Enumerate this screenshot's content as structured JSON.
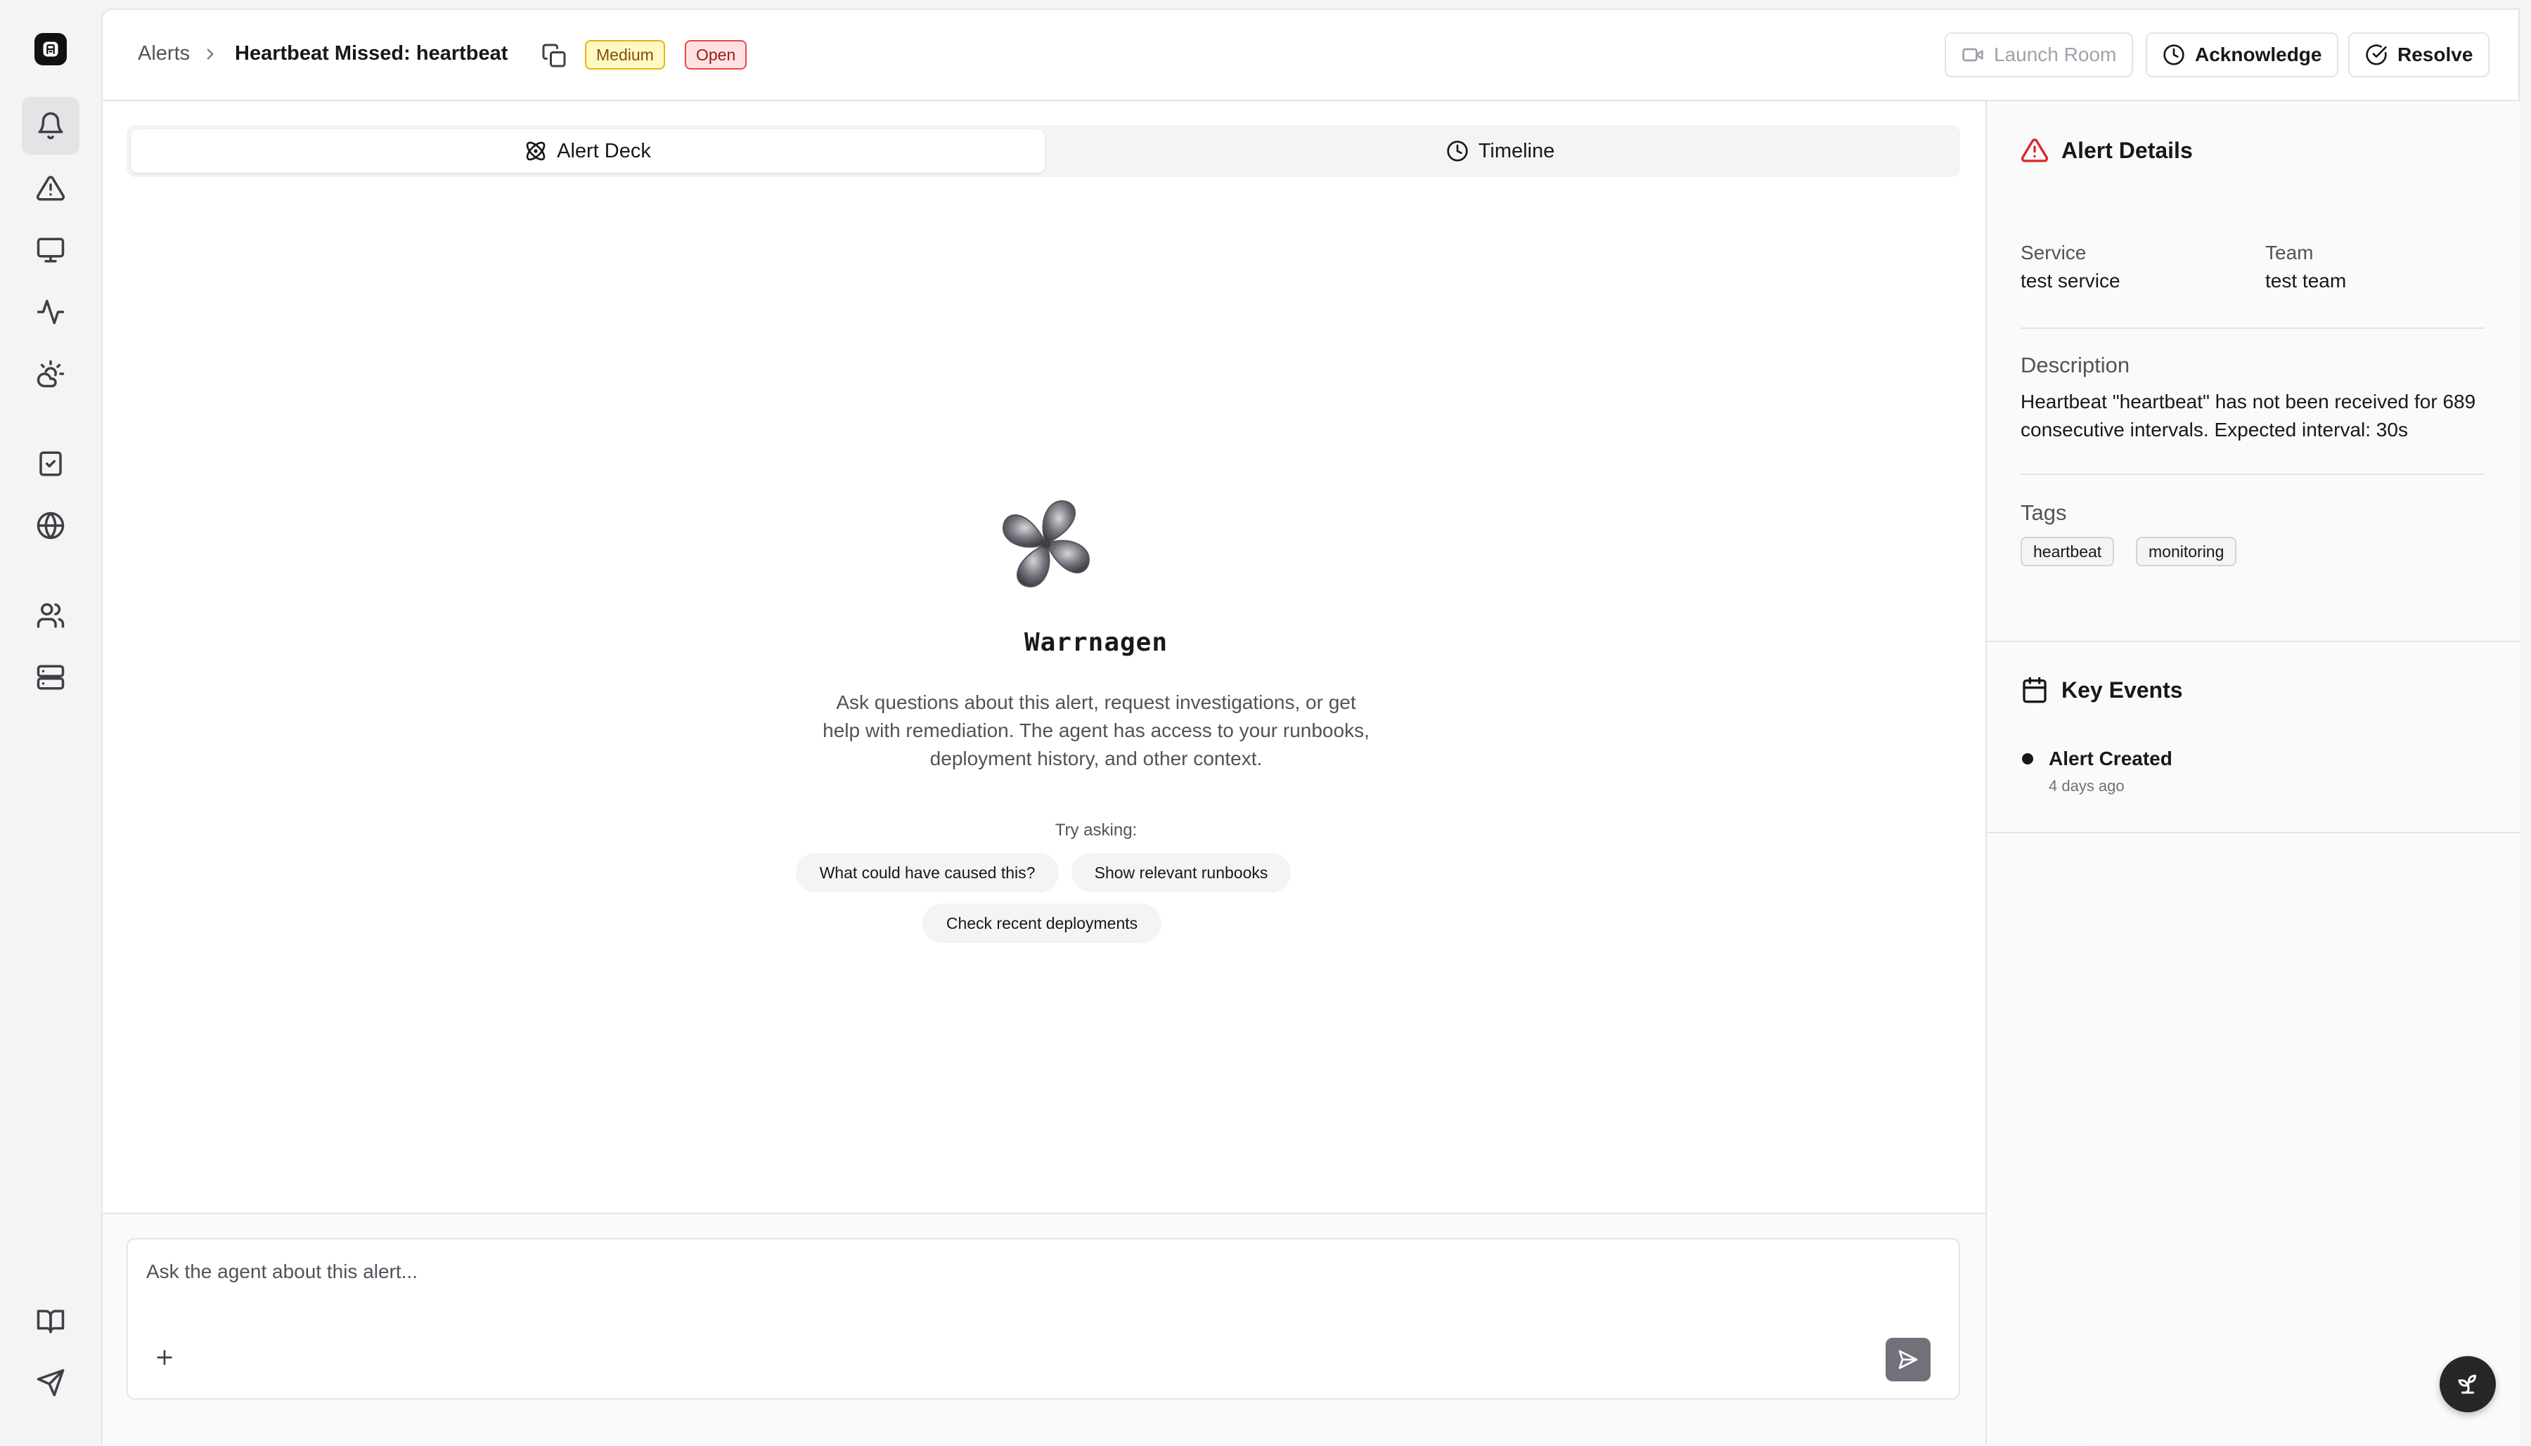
{
  "sidebar": {
    "items": [
      "alerts",
      "incidents",
      "monitors",
      "activity",
      "cloud",
      "tasks",
      "status-pages",
      "teams",
      "services",
      "docs",
      "feedback"
    ]
  },
  "header": {
    "breadcrumb_root": "Alerts",
    "title": "Heartbeat Missed: heartbeat",
    "severity_badge": "Medium",
    "status_badge": "Open",
    "launch_room_label": "Launch Room",
    "acknowledge_label": "Acknowledge",
    "resolve_label": "Resolve"
  },
  "tabs": [
    {
      "label": "Alert Deck",
      "active": true
    },
    {
      "label": "Timeline",
      "active": false
    }
  ],
  "agent": {
    "name": "Warrnagen",
    "description": "Ask questions about this alert, request investigations, or get help with remediation. The agent has access to your runbooks, deployment history, and other context.",
    "try_label": "Try asking:",
    "suggestions": [
      "What could have caused this?",
      "Show relevant runbooks",
      "Check recent deployments"
    ]
  },
  "composer": {
    "placeholder": "Ask the agent about this alert..."
  },
  "details": {
    "title": "Alert Details",
    "service_label": "Service",
    "service_value": "test service",
    "team_label": "Team",
    "team_value": "test team",
    "description_label": "Description",
    "description_value": "Heartbeat \"heartbeat\" has not been received for 689 consecutive intervals. Expected interval: 30s",
    "tags_label": "Tags",
    "tags": [
      "heartbeat",
      "monitoring"
    ]
  },
  "key_events": {
    "title": "Key Events",
    "events": [
      {
        "title": "Alert Created",
        "time": "4 days ago"
      }
    ]
  },
  "colors": {
    "accent_dark": "#18181b",
    "severity_medium_bg": "#fef9c3",
    "severity_medium_border": "#eab308",
    "status_open_bg": "#fee2e2",
    "status_open_border": "#ef4444",
    "alert_icon": "#dc2626"
  }
}
